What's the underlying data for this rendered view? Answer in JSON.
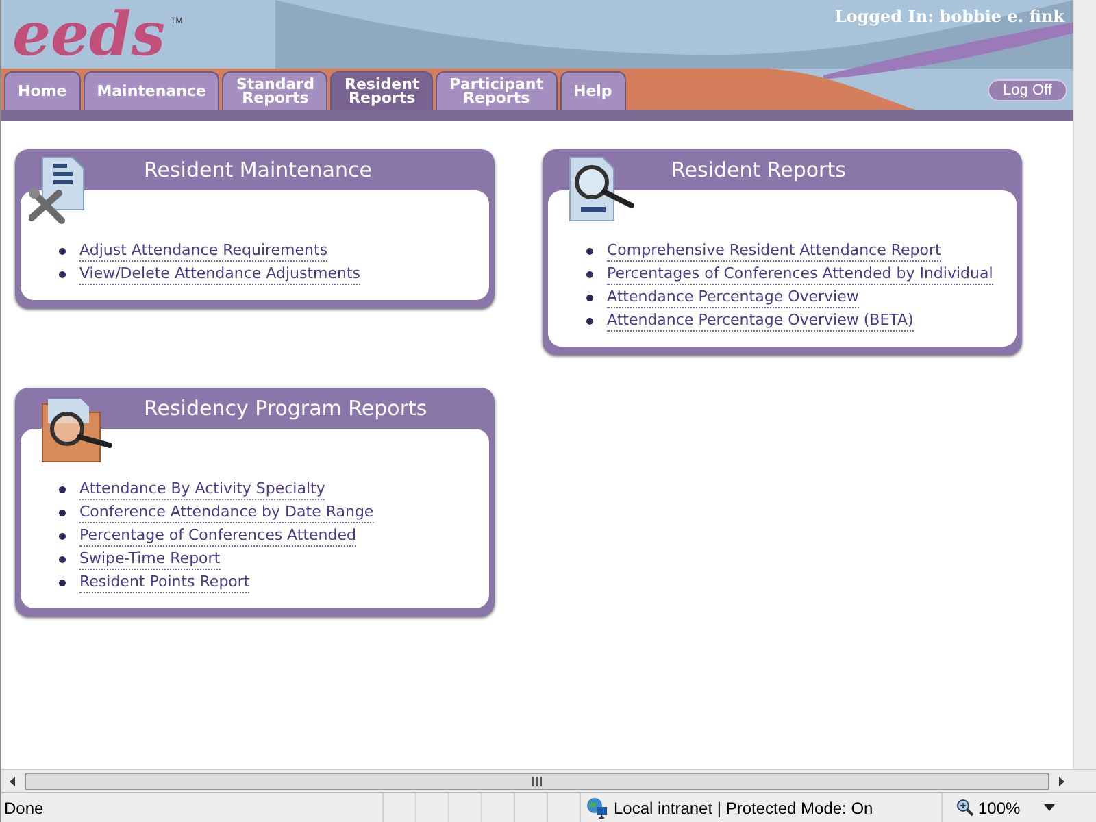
{
  "header": {
    "logo": "eeds",
    "trademark": "TM",
    "logged_in": "Logged In: bobbie e. fink",
    "log_off": "Log Off"
  },
  "tabs": [
    {
      "label": "Home",
      "selected": false
    },
    {
      "label": "Maintenance",
      "selected": false
    },
    {
      "label": "Standard\nReports",
      "selected": false
    },
    {
      "label": "Resident\nReports",
      "selected": true
    },
    {
      "label": "Participant\nReports",
      "selected": false
    },
    {
      "label": "Help",
      "selected": false
    }
  ],
  "panels": [
    {
      "title": "Resident Maintenance",
      "kind": "wrench",
      "links": [
        "Adjust Attendance Requirements",
        "View/Delete Attendance Adjustments"
      ]
    },
    {
      "title": "Resident Reports",
      "kind": "magnifier",
      "links": [
        "Comprehensive Resident Attendance Report",
        "Percentages of Conferences Attended by Individual",
        "Attendance Percentage Overview",
        "Attendance Percentage Overview (BETA)"
      ]
    },
    {
      "title": "Residency Program Reports",
      "kind": "folder",
      "links": [
        "Attendance By Activity Specialty",
        "Conference Attendance by Date Range",
        "Percentage of Conferences Attended",
        "Swipe-Time Report",
        "Resident Points Report"
      ]
    }
  ],
  "status_bar": {
    "status": "Done",
    "zone": "Local intranet | Protected Mode: On",
    "zoom": "100%"
  }
}
